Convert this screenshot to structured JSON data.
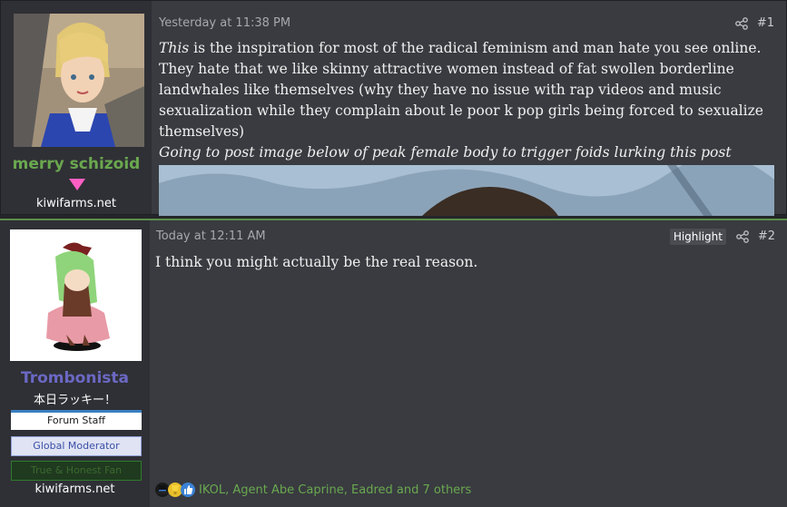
{
  "posts": [
    {
      "user": {
        "name": "merry schizoid",
        "site": "kiwifarms.net"
      },
      "date": "Yesterday at 11:38 PM",
      "number": "#1",
      "body": {
        "emphasis": "This",
        "text": " is the inspiration for most of the radical feminism and man hate you see online. They hate that we like skinny attractive women instead of fat swollen borderline landwhales like themselves (why they have no issue with rap videos and music sexualization while they complain about le poor k pop girls being forced to sexualize themselves)",
        "italic_line": "Going to post image below of peak female body to trigger foids lurking this post"
      }
    },
    {
      "user": {
        "name": "Trombonista",
        "title": "本日ラッキー！",
        "banners": [
          "Forum Staff",
          "Global Moderator",
          "True & Honest Fan"
        ],
        "site": "kiwifarms.net"
      },
      "date": "Today at 12:11 AM",
      "highlight_label": "Highlight",
      "number": "#2",
      "body": {
        "text": "I think you might actually be the real reason."
      },
      "reactions": {
        "icons": [
          "tophat-icon",
          "winner-icon",
          "like-icon"
        ],
        "text": "IKOL, Agent Abe Caprine, Eadred and 7 others"
      }
    }
  ],
  "colors": {
    "username_green": "#6aa84f",
    "username_purple": "#6b68c4",
    "gender_pink": "#ff5fc4",
    "reaction_text": "#6aa84f"
  }
}
